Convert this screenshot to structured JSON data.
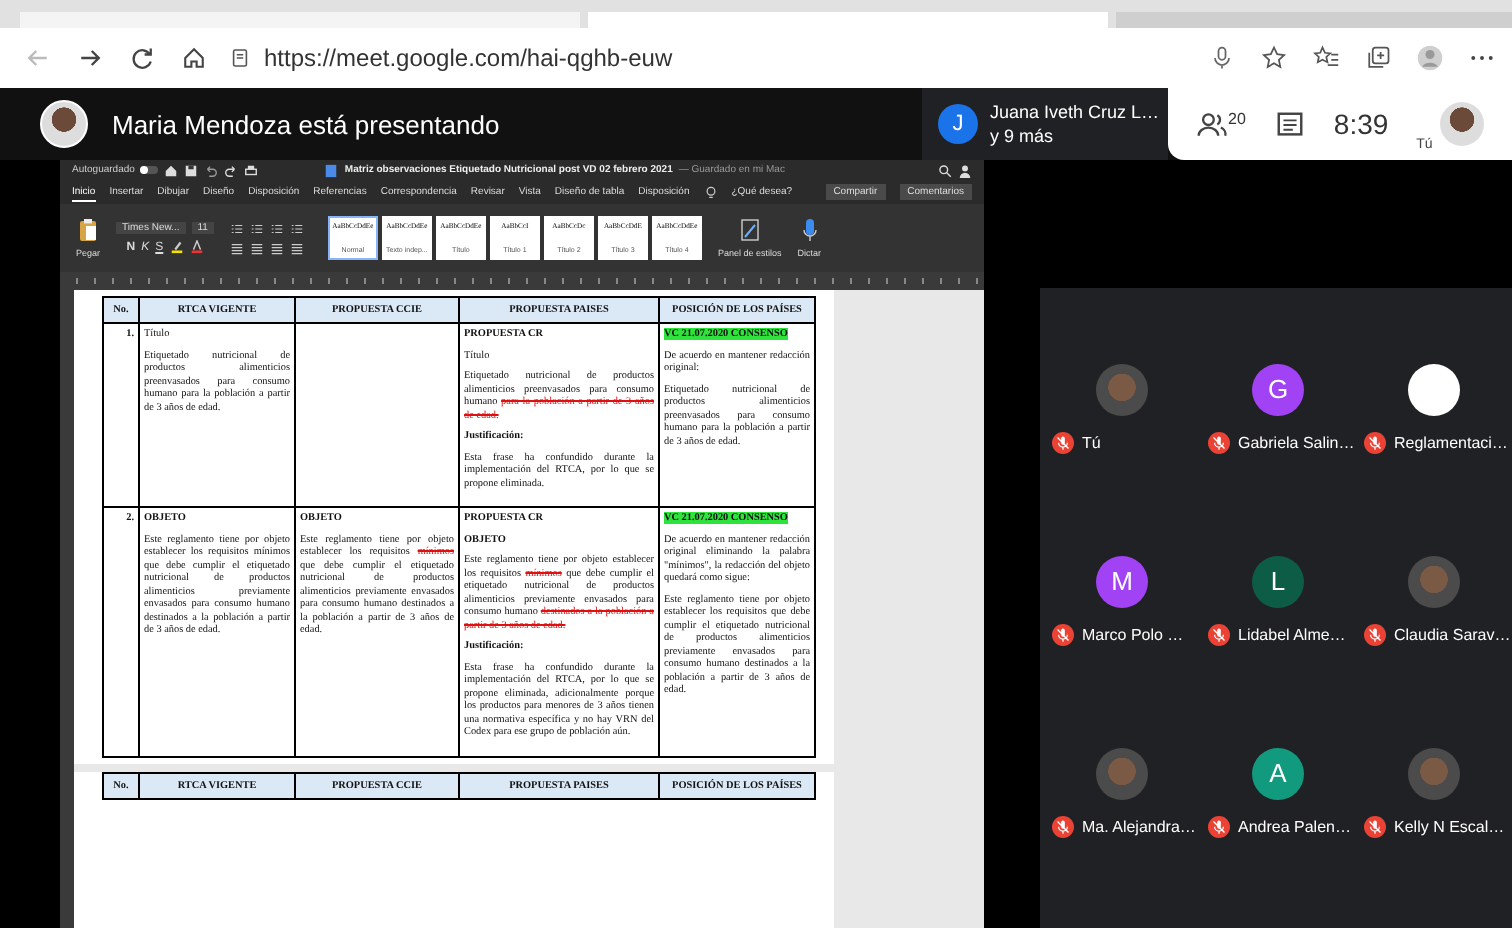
{
  "browser": {
    "url": "https://meet.google.com/hai-qghb-euw"
  },
  "meet": {
    "presenter": "Maria Mendoza está presentando",
    "pinned": {
      "initial": "J",
      "name": "Juana Iveth Cruz L…",
      "more": "y 9 más"
    },
    "participants_count": "20",
    "time": "8:39",
    "self_label": "Tú"
  },
  "document": {
    "autosave": "Autoguardado",
    "autosave_on": false,
    "title": "Matriz observaciones Etiquetado Nutricional post VD 02 febrero 2021",
    "save_status": "— Guardado en mi Mac",
    "ribbon_tabs": [
      {
        "label": "Inicio",
        "selected": true
      },
      {
        "label": "Insertar",
        "selected": false
      },
      {
        "label": "Dibujar",
        "selected": false
      },
      {
        "label": "Diseño",
        "selected": false
      },
      {
        "label": "Disposición",
        "selected": false
      },
      {
        "label": "Referencias",
        "selected": false
      },
      {
        "label": "Correspondencia",
        "selected": false
      },
      {
        "label": "Revisar",
        "selected": false
      },
      {
        "label": "Vista",
        "selected": false
      },
      {
        "label": "Diseño de tabla",
        "selected": false
      },
      {
        "label": "Disposición",
        "selected": false
      }
    ],
    "search_hint": "¿Qué desea?",
    "share": "Compartir",
    "comments": "Comentarios",
    "paste": "Pegar",
    "font": "Times New...",
    "font_size": "11",
    "format_buttons": [
      "N",
      "K",
      "S"
    ],
    "styles": [
      {
        "sample": "AaBbCcDdEe",
        "name": "Normal",
        "selected": true
      },
      {
        "sample": "AaBbCcDdEe",
        "name": "Texto indep...",
        "selected": false
      },
      {
        "sample": "AaBbCcDdEe",
        "name": "Título",
        "selected": false
      },
      {
        "sample": "AaBbCcI",
        "name": "Título 1",
        "selected": false
      },
      {
        "sample": "AaBbCcDc",
        "name": "Título 2",
        "selected": false
      },
      {
        "sample": "AaBbCcDdE",
        "name": "Título 3",
        "selected": false
      },
      {
        "sample": "AaBbCcDdEe",
        "name": "Título 4",
        "selected": false
      }
    ],
    "styles_pane": "Panel de estilos",
    "dictate": "Dictar",
    "table": {
      "columns": [
        "No.",
        "RTCA VIGENTE",
        "PROPUESTA CCIE",
        "PROPUESTA PAISES",
        "POSICIÓN DE LOS PAÍSES"
      ],
      "rows": [
        {
          "cells": [
            [
              {
                "kind": "number",
                "parts": [
                  {
                    "text": "1.",
                    "deleted": false
                  }
                ]
              }
            ],
            [
              {
                "kind": "plain",
                "parts": [
                  {
                    "text": "Título",
                    "deleted": false
                  }
                ]
              },
              {
                "kind": "plain",
                "parts": [
                  {
                    "text": "Etiquetado nutricional de productos alimenticios preenvasados para consumo humano para la población a partir de 3 años de edad.",
                    "deleted": false
                  }
                ]
              }
            ],
            [],
            [
              {
                "kind": "bold",
                "parts": [
                  {
                    "text": "PROPUESTA CR",
                    "deleted": false
                  }
                ]
              },
              {
                "kind": "plain",
                "parts": [
                  {
                    "text": "Título",
                    "deleted": false
                  }
                ]
              },
              {
                "kind": "plain",
                "parts": [
                  {
                    "text": "Etiquetado nutricional de productos alimenticios preenvasados para consumo humano ",
                    "deleted": false
                  },
                  {
                    "text": "para la población a partir de 3 años de edad.",
                    "deleted": true
                  }
                ]
              },
              {
                "kind": "bold",
                "parts": [
                  {
                    "text": "Justificación:",
                    "deleted": false
                  }
                ]
              },
              {
                "kind": "plain",
                "parts": [
                  {
                    "text": "Esta frase ha confundido durante la implementación del RTCA, por lo que se propone eliminada.",
                    "deleted": false
                  }
                ]
              }
            ],
            [
              {
                "kind": "highlight",
                "parts": [
                  {
                    "text": "VC 21.07.2020 CONSENSO",
                    "deleted": false
                  }
                ]
              },
              {
                "kind": "plain",
                "parts": [
                  {
                    "text": "De acuerdo en mantener redacción original:",
                    "deleted": false
                  }
                ]
              },
              {
                "kind": "plain",
                "parts": [
                  {
                    "text": "Etiquetado nutricional de productos alimenticios preenvasados para consumo humano para la población a partir de 3 años de edad.",
                    "deleted": false
                  }
                ]
              }
            ]
          ]
        },
        {
          "cells": [
            [
              {
                "kind": "number",
                "parts": [
                  {
                    "text": "2.",
                    "deleted": false
                  }
                ]
              }
            ],
            [
              {
                "kind": "bold",
                "parts": [
                  {
                    "text": "OBJETO",
                    "deleted": false
                  }
                ]
              },
              {
                "kind": "plain",
                "parts": [
                  {
                    "text": "Este reglamento tiene por objeto establecer los requisitos mínimos que debe cumplir el etiquetado nutricional de productos alimenticios previamente envasados para consumo humano destinados a la población a partir de 3 años de edad.",
                    "deleted": false
                  }
                ]
              }
            ],
            [
              {
                "kind": "bold",
                "parts": [
                  {
                    "text": "OBJETO",
                    "deleted": false
                  }
                ]
              },
              {
                "kind": "plain",
                "parts": [
                  {
                    "text": "Este reglamento tiene por objeto establecer los requisitos ",
                    "deleted": false
                  },
                  {
                    "text": "mínimos",
                    "deleted": true
                  },
                  {
                    "text": " que debe cumplir el etiquetado nutricional de productos alimenticios previamente envasados para consumo humano destinados a la población a partir de 3 años de edad.",
                    "deleted": false
                  }
                ]
              }
            ],
            [
              {
                "kind": "bold",
                "parts": [
                  {
                    "text": "PROPUESTA CR",
                    "deleted": false
                  }
                ]
              },
              {
                "kind": "bold",
                "parts": [
                  {
                    "text": "OBJETO",
                    "deleted": false
                  }
                ]
              },
              {
                "kind": "plain",
                "parts": [
                  {
                    "text": "Este reglamento tiene por objeto establecer los requisitos ",
                    "deleted": false
                  },
                  {
                    "text": "mínimos",
                    "deleted": true
                  },
                  {
                    "text": " que debe cumplir el etiquetado nutricional de productos alimenticios previamente envasados para consumo humano ",
                    "deleted": false
                  },
                  {
                    "text": "destinados a la población a partir de 3 años de edad.",
                    "deleted": true
                  }
                ]
              },
              {
                "kind": "bold",
                "parts": [
                  {
                    "text": "Justificación:",
                    "deleted": false
                  }
                ]
              },
              {
                "kind": "plain",
                "parts": [
                  {
                    "text": "Esta frase ha confundido durante la implementación del RTCA, por lo que se propone eliminada, adicionalmente porque los productos para menores de 3 años tienen una normativa específica y no hay VRN del Codex para ese grupo de población aún.",
                    "deleted": false
                  }
                ]
              }
            ],
            [
              {
                "kind": "highlight",
                "parts": [
                  {
                    "text": "VC 21.07.2020 CONSENSO",
                    "deleted": false
                  }
                ]
              },
              {
                "kind": "plain",
                "parts": [
                  {
                    "text": "De acuerdo en mantener redacción original eliminando la palabra \"mínimos\", la redacción del objeto quedará como sigue:",
                    "deleted": false
                  }
                ]
              },
              {
                "kind": "plain",
                "parts": [
                  {
                    "text": "Este reglamento tiene por objeto establecer los requisitos que debe cumplir el etiquetado nutricional de productos alimenticios previamente envasados para consumo humano destinados a la población a partir de 3 años de edad.",
                    "deleted": false
                  }
                ]
              }
            ]
          ]
        }
      ],
      "next_page_columns": [
        "No.",
        "RTCA VIGENTE",
        "PROPUESTA CCIE",
        "PROPUESTA PAISES",
        "POSICIÓN DE LOS PAÍSES"
      ]
    }
  },
  "participants": [
    {
      "name": "Tú",
      "kind": "photo",
      "muted": true
    },
    {
      "name": "Gabriela Salin…",
      "kind": "letter",
      "initial": "G",
      "color": "#a142f4",
      "muted": true
    },
    {
      "name": "Reglamentaci…",
      "kind": "logo",
      "muted": true
    },
    {
      "name": "Marco Polo …",
      "kind": "letter",
      "initial": "M",
      "color": "#a142f4",
      "muted": true
    },
    {
      "name": "Lidabel Alme…",
      "kind": "letter",
      "initial": "L",
      "color": "#0d5c46",
      "muted": true
    },
    {
      "name": "Claudia Sarav…",
      "kind": "photo",
      "muted": true
    },
    {
      "name": "Ma. Alejandra…",
      "kind": "photo",
      "muted": true
    },
    {
      "name": "Andrea Palen…",
      "kind": "letter",
      "initial": "A",
      "color": "#129a7f",
      "muted": true
    },
    {
      "name": "Kelly N Escal…",
      "kind": "photo",
      "muted": true
    }
  ]
}
